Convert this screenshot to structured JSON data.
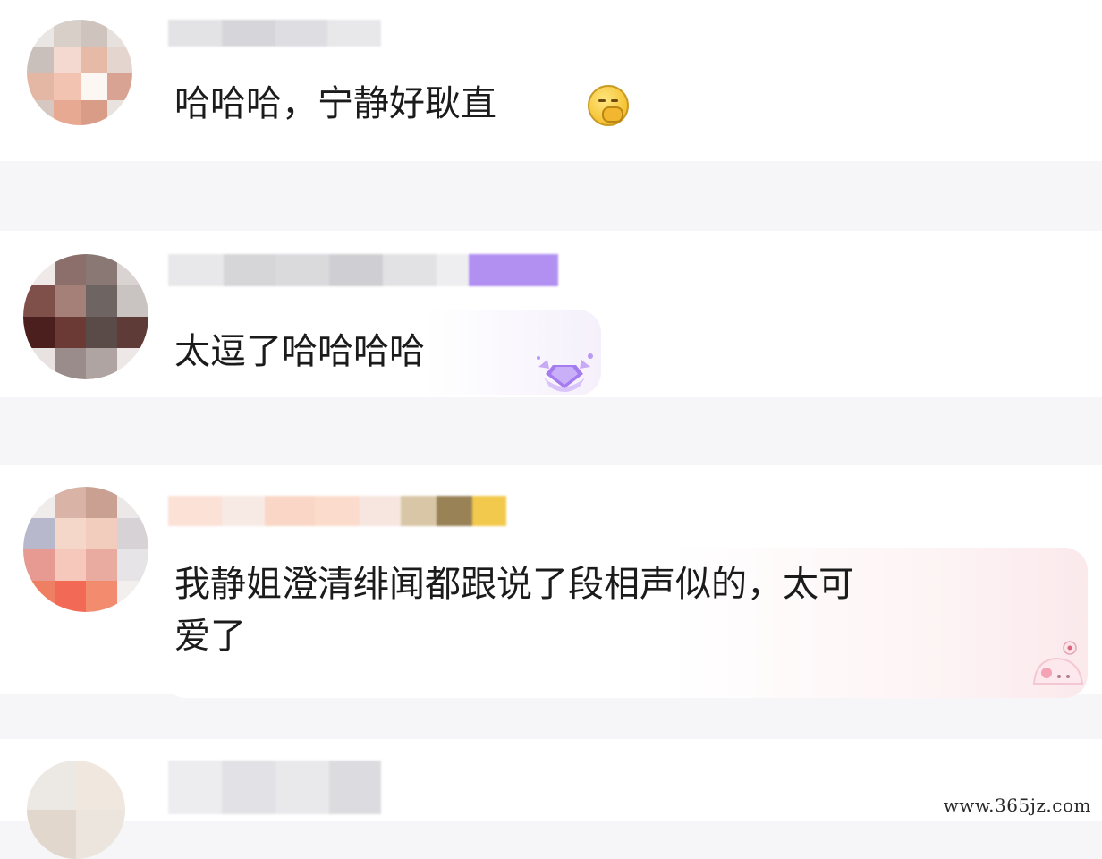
{
  "comments": [
    {
      "text": "哈哈哈，宁静好耿直",
      "emoji": "face-with-hand-over-mouth-emoji"
    },
    {
      "text": "太逗了哈哈哈哈",
      "badge": "purple-gem-badge"
    },
    {
      "text": "我静姐澄清绯闻都跟说了段相声似的，太可\n爱了",
      "badge": "cute-sticker-badge"
    }
  ],
  "watermark": "www.365jz.com",
  "colors": {
    "background": "#f6f6f8",
    "card": "#ffffff",
    "text": "#1b1b1b",
    "vip_purple": "#a57cf0",
    "bubble_pink": "#fdf1f4"
  }
}
